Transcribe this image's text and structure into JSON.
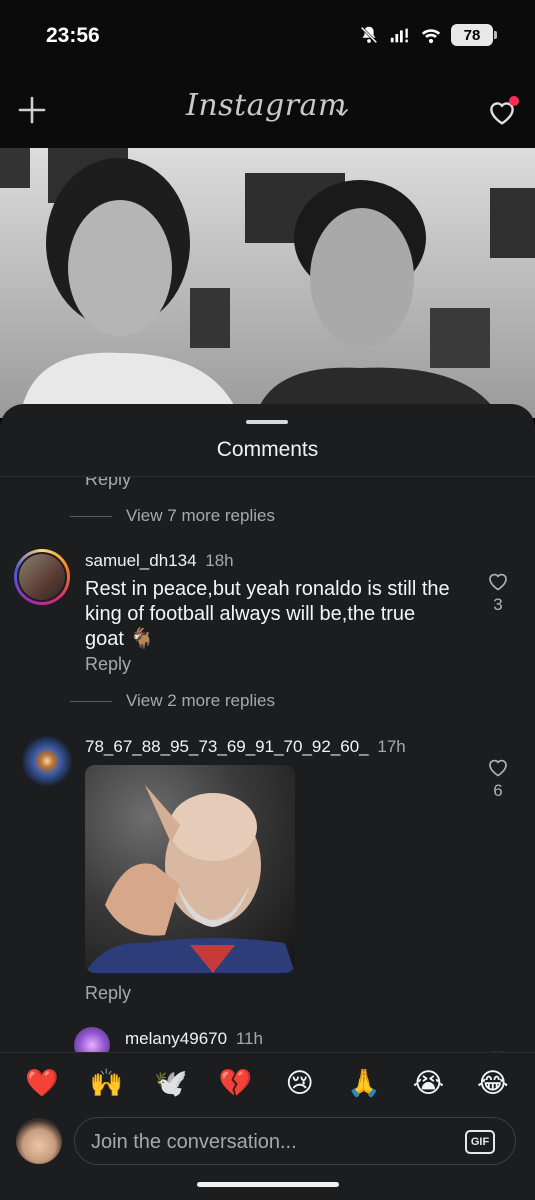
{
  "status_bar": {
    "time": "23:56",
    "battery": "78"
  },
  "header": {
    "logo": "Instagram",
    "colors": {
      "background": "#0b0b0c",
      "notification_dot": "#ff2d55"
    }
  },
  "comments_sheet": {
    "title": "Comments",
    "top_reply_label": "Reply",
    "view_more_1": "View 7 more replies",
    "comments": [
      {
        "username": "samuel_dh134",
        "time": "18h",
        "text": "Rest in peace,but yeah ronaldo is still the king of football always will be,the true goat 🐐",
        "likes": "3",
        "reply_label": "Reply"
      },
      {
        "username": "78_67_88_95_73_69_91_70_92_60_",
        "time": "17h",
        "likes": "6",
        "reply_label": "Reply"
      },
      {
        "username": "melany49670",
        "time": "11h"
      }
    ],
    "view_more_2": "View 2 more replies"
  },
  "emoji_bar": [
    "❤️",
    "🙌",
    "🕊️",
    "💔",
    "😢",
    "🙏",
    "😭",
    "😂"
  ],
  "composer": {
    "placeholder": "Join the conversation...",
    "gif_label": "GIF"
  }
}
